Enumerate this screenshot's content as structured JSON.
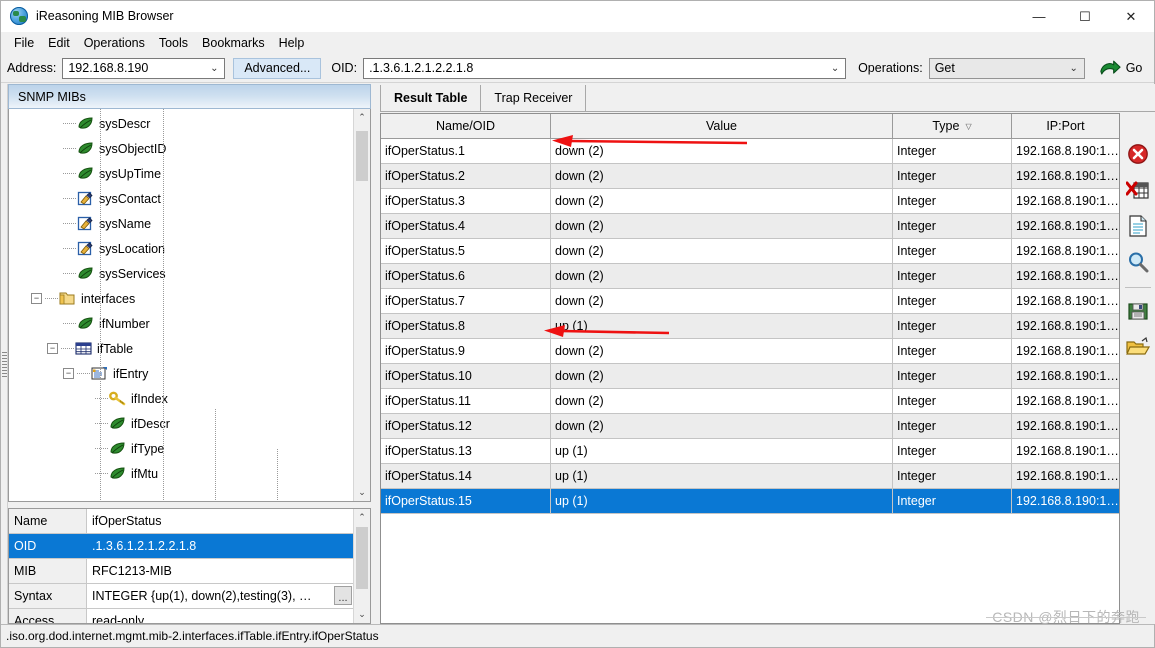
{
  "window": {
    "title": "iReasoning MIB Browser",
    "icon": "globe-icon",
    "minimize": "—",
    "maximize": "☐",
    "close": "✕"
  },
  "menubar": {
    "items": [
      "File",
      "Edit",
      "Operations",
      "Tools",
      "Bookmarks",
      "Help"
    ]
  },
  "toolbar": {
    "address_label": "Address:",
    "address_value": "192.168.8.190",
    "advanced_label": "Advanced...",
    "oid_label": "OID:",
    "oid_value": ".1.3.6.1.2.1.2.2.1.8",
    "operations_label": "Operations:",
    "operations_value": "Get",
    "go_label": "Go",
    "go_icon": "green-arrow-icon"
  },
  "sidebar": {
    "header": "SNMP MIBs",
    "tree": [
      {
        "label": "sysDescr",
        "icon": "leaf-icon",
        "indent": 3,
        "toggle": ""
      },
      {
        "label": "sysObjectID",
        "icon": "leaf-icon",
        "indent": 3,
        "toggle": ""
      },
      {
        "label": "sysUpTime",
        "icon": "leaf-icon",
        "indent": 3,
        "toggle": ""
      },
      {
        "label": "sysContact",
        "icon": "pencil-icon",
        "indent": 3,
        "toggle": ""
      },
      {
        "label": "sysName",
        "icon": "pencil-icon",
        "indent": 3,
        "toggle": ""
      },
      {
        "label": "sysLocation",
        "icon": "pencil-icon",
        "indent": 3,
        "toggle": ""
      },
      {
        "label": "sysServices",
        "icon": "leaf-icon",
        "indent": 3,
        "toggle": ""
      },
      {
        "label": "interfaces",
        "icon": "folder-icon",
        "indent": 1,
        "toggle": "−"
      },
      {
        "label": "ifNumber",
        "icon": "leaf-icon",
        "indent": 3,
        "toggle": ""
      },
      {
        "label": "ifTable",
        "icon": "table-icon",
        "indent": 2,
        "toggle": "−"
      },
      {
        "label": "ifEntry",
        "icon": "entry-icon",
        "indent": 3,
        "toggle": "−"
      },
      {
        "label": "ifIndex",
        "icon": "key-icon",
        "indent": 5,
        "toggle": ""
      },
      {
        "label": "ifDescr",
        "icon": "leaf-icon",
        "indent": 5,
        "toggle": ""
      },
      {
        "label": "ifType",
        "icon": "leaf-icon",
        "indent": 5,
        "toggle": ""
      },
      {
        "label": "ifMtu",
        "icon": "leaf-icon",
        "indent": 5,
        "toggle": ""
      }
    ]
  },
  "properties": {
    "rows": [
      {
        "key": "Name",
        "value": "ifOperStatus",
        "selected": false,
        "ellipsis": false
      },
      {
        "key": "OID",
        "value": ".1.3.6.1.2.1.2.2.1.8",
        "selected": true,
        "ellipsis": false
      },
      {
        "key": "MIB",
        "value": "RFC1213-MIB",
        "selected": false,
        "ellipsis": false
      },
      {
        "key": "Syntax",
        "value": "INTEGER {up(1), down(2),testing(3), …",
        "selected": false,
        "ellipsis": true,
        "ellipsis_label": "..."
      },
      {
        "key": "Access",
        "value": "read-only",
        "selected": false,
        "ellipsis": false
      }
    ]
  },
  "main": {
    "tabs": [
      {
        "label": "Result Table",
        "active": true
      },
      {
        "label": "Trap Receiver",
        "active": false
      }
    ],
    "table": {
      "columns": [
        "Name/OID",
        "Value",
        "Type",
        "IP:Port"
      ],
      "sorted_column": "Type",
      "sort_glyph": "▽",
      "rows": [
        {
          "name": "ifOperStatus.1",
          "value": "down (2)",
          "type": "Integer",
          "ipport": "192.168.8.190:1…",
          "selected": false,
          "annotated": true
        },
        {
          "name": "ifOperStatus.2",
          "value": "down (2)",
          "type": "Integer",
          "ipport": "192.168.8.190:1…",
          "selected": false,
          "annotated": false
        },
        {
          "name": "ifOperStatus.3",
          "value": "down (2)",
          "type": "Integer",
          "ipport": "192.168.8.190:1…",
          "selected": false,
          "annotated": false
        },
        {
          "name": "ifOperStatus.4",
          "value": "down (2)",
          "type": "Integer",
          "ipport": "192.168.8.190:1…",
          "selected": false,
          "annotated": false
        },
        {
          "name": "ifOperStatus.5",
          "value": "down (2)",
          "type": "Integer",
          "ipport": "192.168.8.190:1…",
          "selected": false,
          "annotated": false
        },
        {
          "name": "ifOperStatus.6",
          "value": "down (2)",
          "type": "Integer",
          "ipport": "192.168.8.190:1…",
          "selected": false,
          "annotated": false
        },
        {
          "name": "ifOperStatus.7",
          "value": "down (2)",
          "type": "Integer",
          "ipport": "192.168.8.190:1…",
          "selected": false,
          "annotated": false
        },
        {
          "name": "ifOperStatus.8",
          "value": "up (1)",
          "type": "Integer",
          "ipport": "192.168.8.190:1…",
          "selected": false,
          "annotated": true
        },
        {
          "name": "ifOperStatus.9",
          "value": "down (2)",
          "type": "Integer",
          "ipport": "192.168.8.190:1…",
          "selected": false,
          "annotated": false
        },
        {
          "name": "ifOperStatus.10",
          "value": "down (2)",
          "type": "Integer",
          "ipport": "192.168.8.190:1…",
          "selected": false,
          "annotated": false
        },
        {
          "name": "ifOperStatus.11",
          "value": "down (2)",
          "type": "Integer",
          "ipport": "192.168.8.190:1…",
          "selected": false,
          "annotated": false
        },
        {
          "name": "ifOperStatus.12",
          "value": "down (2)",
          "type": "Integer",
          "ipport": "192.168.8.190:1…",
          "selected": false,
          "annotated": false
        },
        {
          "name": "ifOperStatus.13",
          "value": "up (1)",
          "type": "Integer",
          "ipport": "192.168.8.190:1…",
          "selected": false,
          "annotated": false
        },
        {
          "name": "ifOperStatus.14",
          "value": "up (1)",
          "type": "Integer",
          "ipport": "192.168.8.190:1…",
          "selected": false,
          "annotated": false
        },
        {
          "name": "ifOperStatus.15",
          "value": "up (1)",
          "type": "Integer",
          "ipport": "192.168.8.190:1…",
          "selected": true,
          "annotated": false
        }
      ]
    },
    "side_tools": [
      {
        "name": "stop-icon"
      },
      {
        "name": "clear-table-icon"
      },
      {
        "name": "new-document-icon"
      },
      {
        "name": "magnifier-icon"
      },
      {
        "name": "save-icon"
      },
      {
        "name": "open-folder-icon"
      }
    ]
  },
  "statusbar": {
    "path": ".iso.org.dod.internet.mgmt.mib-2.interfaces.ifTable.ifEntry.ifOperStatus"
  },
  "watermark": {
    "text": "CSDN @烈日下的奔跑"
  },
  "colors": {
    "selection_blue": "#0a78d4",
    "annotation_red": "#ee1111",
    "header_blue": "#bcd3ea",
    "go_green": "#1a8a33"
  }
}
